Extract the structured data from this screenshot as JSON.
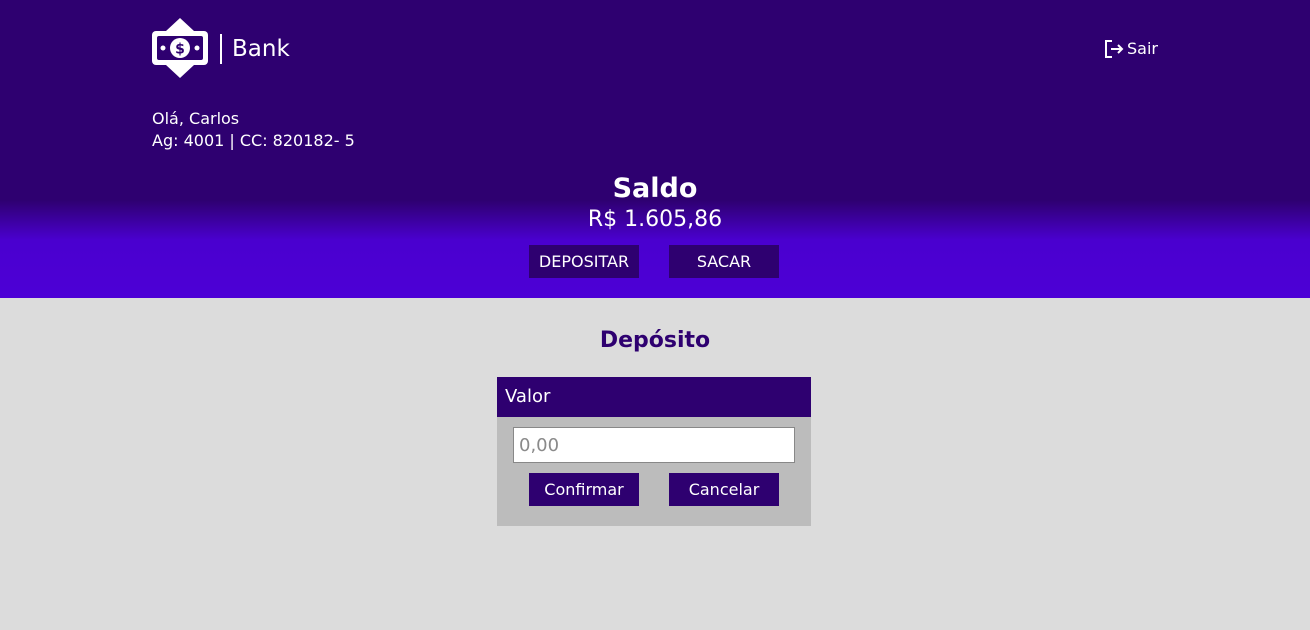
{
  "brand": {
    "name": "Bank",
    "logo_icon": "money-bill-icon"
  },
  "header": {
    "logout_label": "Sair",
    "logout_icon": "sign-out-icon",
    "greeting": "Olá, Carlos",
    "account": "Ag: 4001 | CC: 820182- 5",
    "balance_title": "Saldo",
    "balance_value": "R$ 1.605,86",
    "actions": {
      "deposit": "DEPOSITAR",
      "withdraw": "SACAR"
    }
  },
  "deposit": {
    "title": "Depósito",
    "field_label": "Valor",
    "input_placeholder": "0,00",
    "input_value": "",
    "confirm_label": "Confirmar",
    "cancel_label": "Cancelar"
  },
  "colors": {
    "primary": "#2e0070",
    "header_gradient_end": "#4d00d6",
    "background": "#dcdcdc",
    "card_body": "#bcbcbc"
  }
}
